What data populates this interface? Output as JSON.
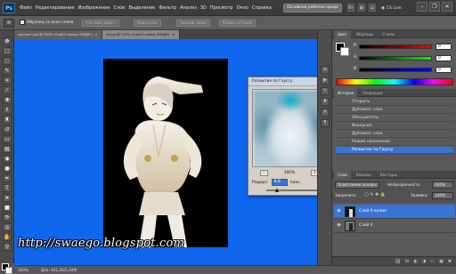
{
  "app": {
    "logo": "Ps",
    "menu": [
      "Файл",
      "Редактирование",
      "Изображение",
      "Слои",
      "Выделение",
      "Фильтр",
      "Анализ",
      "3D",
      "Просмотр",
      "Окно",
      "Справка"
    ],
    "workspace_button": "Основная рабочая среда",
    "cs_live": "CS Live",
    "window_controls": [
      "–",
      "❐",
      "✕"
    ]
  },
  "options_bar": {
    "checkbox_label": "Образец со всех слоев",
    "buttons": [
      "Уточнить края...",
      "Подогнать",
      "Полный экран",
      "Размер оттиска"
    ]
  },
  "tabs": [
    {
      "label": "портрет.psd @ 100% (Слой 0 копия, RGB/8*)",
      "close": "×",
      "active": false
    },
    {
      "label": "09.jpg @ 100% (Слой 0 копия, RGB/8*)",
      "close": "×",
      "active": true
    }
  ],
  "status_bar": {
    "zoom": "100%",
    "info": "Док: 441,2K/1,44M"
  },
  "watermark": "http://swaego.blogspot.com",
  "dialog": {
    "title": "Размытие по Гауссу",
    "close": "x",
    "ok": "OK",
    "cancel": "Отмена",
    "preview_label": "Просмотр",
    "preview_checked": "✓",
    "zoom_minus": "–",
    "zoom_value": "100%",
    "zoom_plus": "+",
    "radius_label": "Радиус:",
    "radius_value": "9,8",
    "radius_unit": "пикс.",
    "radius_slider_fraction": 0.2
  },
  "panels": {
    "color_tabs": [
      "Цвет",
      "Образцы",
      "Стили"
    ],
    "channels": [
      {
        "label": "R",
        "value": "0",
        "gradient": "#000000"
      },
      {
        "label": "G",
        "value": "0",
        "gradient": "#000000"
      },
      {
        "label": "B",
        "value": "0",
        "gradient": "#000000"
      }
    ],
    "history_tabs": [
      "История",
      "Операции"
    ],
    "history_items": [
      {
        "label": "Открыть",
        "selected": false
      },
      {
        "label": "Дубликат слоя",
        "selected": false
      },
      {
        "label": "Обесцветить",
        "selected": false
      },
      {
        "label": "Инверсия",
        "selected": false
      },
      {
        "label": "Дубликат слоя",
        "selected": false
      },
      {
        "label": "Режим наложения",
        "selected": false
      },
      {
        "label": "Размытие по Гауссу",
        "selected": true
      }
    ],
    "layers_tabs": [
      "Слои",
      "Каналы",
      "Контуры"
    ],
    "blend_mode": "Осветление основы",
    "opacity_label": "Непрозрачность:",
    "opacity_value": "100%",
    "lock_label": "Закрепить:",
    "fill_label": "Заливка:",
    "fill_value": "100%",
    "layers": [
      {
        "name": "Слой 0 копия",
        "selected": true,
        "eye": "👁"
      },
      {
        "name": "Слой 0",
        "selected": false,
        "eye": "👁"
      }
    ]
  },
  "tool_icons": [
    "move-icon",
    "marquee-icon",
    "lasso-icon",
    "quick-select-icon",
    "crop-icon",
    "eyedropper-icon",
    "healing-icon",
    "brush-icon",
    "stamp-icon",
    "history-brush-icon",
    "eraser-icon",
    "gradient-icon",
    "blur-icon",
    "dodge-icon",
    "pen-icon",
    "type-icon",
    "path-select-icon",
    "shape-icon",
    "3d-rotate-icon",
    "3d-camera-icon",
    "hand-icon",
    "zoom-icon"
  ],
  "colors": {
    "canvas": "#0f67ee",
    "selection": "#3875d7"
  }
}
